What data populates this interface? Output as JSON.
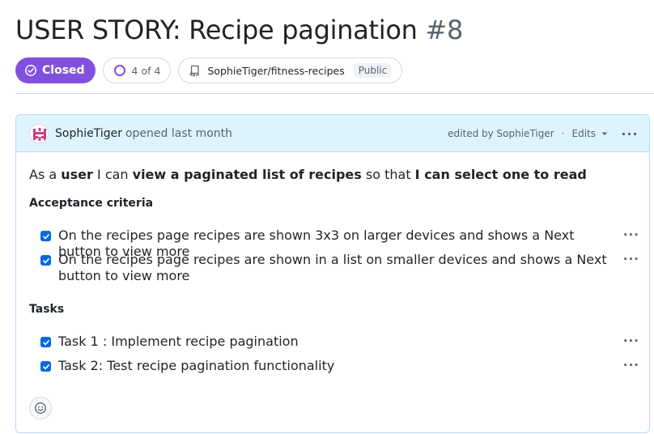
{
  "issue": {
    "title_text": "USER STORY: Recipe pagination",
    "number": "#8",
    "state_label": "Closed",
    "tasks_progress": "4 of 4",
    "repo": "SophieTiger/fitness-recipes",
    "visibility": "Public"
  },
  "comment": {
    "author": "SophieTiger",
    "opened_text": "opened last month",
    "edited_text": "edited by SophieTiger",
    "edits_label": "Edits",
    "story": {
      "p1": "As a ",
      "b1": "user",
      "p2": " I can ",
      "b2": "view a paginated list of recipes",
      "p3": " so that ",
      "b3": "I can select one to read"
    },
    "acceptance_heading": "Acceptance criteria",
    "acceptance_items": [
      {
        "text": "On the recipes page recipes are shown 3x3 on larger devices and shows a Next button to view more",
        "checked": true
      },
      {
        "text": "On the recipes page recipes are shown in a list on smaller devices and shows a Next button to view more",
        "checked": true
      }
    ],
    "tasks_heading": "Tasks",
    "task_items": [
      {
        "text": "Task 1 : Implement recipe pagination",
        "checked": true
      },
      {
        "text": "Task 2: Test recipe pagination functionality",
        "checked": true
      }
    ]
  },
  "colors": {
    "closed_purple": "#8250df",
    "header_blue": "#ddf4ff",
    "checkbox_blue": "#0969da"
  },
  "icons": [
    "issue-closed-icon",
    "progress-ring-icon",
    "repo-icon",
    "kebab-icon",
    "caret-down-icon",
    "checkbox-checked-icon",
    "smiley-icon",
    "identicon-avatar"
  ]
}
